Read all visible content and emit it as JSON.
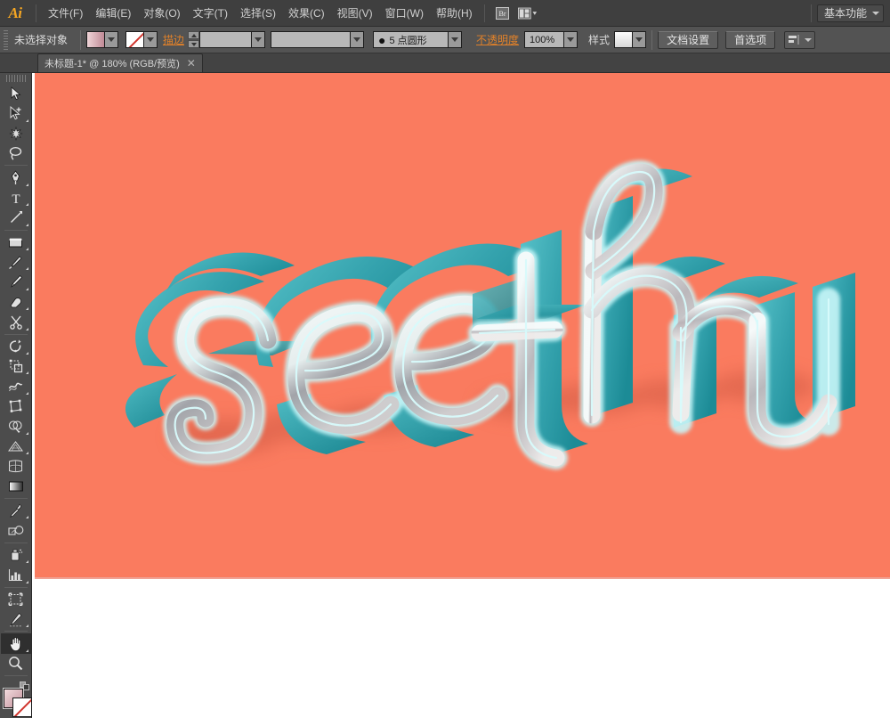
{
  "app": {
    "name": "Adobe Illustrator",
    "logo_text": "Ai"
  },
  "menubar": {
    "items": [
      {
        "label": "文件(F)",
        "name": "menu-file"
      },
      {
        "label": "编辑(E)",
        "name": "menu-edit"
      },
      {
        "label": "对象(O)",
        "name": "menu-object"
      },
      {
        "label": "文字(T)",
        "name": "menu-type"
      },
      {
        "label": "选择(S)",
        "name": "menu-select"
      },
      {
        "label": "效果(C)",
        "name": "menu-effect"
      },
      {
        "label": "视图(V)",
        "name": "menu-view"
      },
      {
        "label": "窗口(W)",
        "name": "menu-window"
      },
      {
        "label": "帮助(H)",
        "name": "menu-help"
      }
    ],
    "bridge_icon": "bridge-icon",
    "arrange_icon": "arrange-documents-icon",
    "workspace": "基本功能"
  },
  "controlbar": {
    "selection_status": "未选择对象",
    "fill_label": "fill-swatch",
    "stroke_color_label": "stroke-color-swatch",
    "stroke_label": "描边",
    "stroke_weight_value": "",
    "stroke_profile_value": "",
    "brush_value": "5 点圆形",
    "brush_bullet": "●",
    "opacity_label": "不透明度",
    "opacity_value": "100%",
    "style_label": "样式",
    "document_setup": "文档设置",
    "preferences": "首选项",
    "align_icon": "align-objects-icon"
  },
  "tabbar": {
    "document_title": "未标题-1* @ 180% (RGB/预览)",
    "close_glyph": "✕"
  },
  "toolbar": {
    "tools": [
      {
        "name": "selection-tool",
        "title": "选择工具",
        "active": false,
        "corner": false
      },
      {
        "name": "direct-selection-tool",
        "title": "直接选择工具",
        "active": false,
        "corner": true
      },
      {
        "name": "magic-wand-tool",
        "title": "魔棒工具",
        "active": false,
        "corner": false
      },
      {
        "name": "lasso-tool",
        "title": "套索工具",
        "active": false,
        "corner": false
      },
      {
        "name": "pen-tool",
        "title": "钢笔工具",
        "active": false,
        "corner": true
      },
      {
        "name": "type-tool",
        "title": "文字工具",
        "active": false,
        "corner": true
      },
      {
        "name": "line-segment-tool",
        "title": "直线段工具",
        "active": false,
        "corner": true
      },
      {
        "name": "rectangle-tool",
        "title": "矩形工具",
        "active": false,
        "corner": true
      },
      {
        "name": "paintbrush-tool",
        "title": "画笔工具",
        "active": false,
        "corner": true
      },
      {
        "name": "pencil-tool",
        "title": "铅笔工具",
        "active": false,
        "corner": true
      },
      {
        "name": "blob-brush-tool",
        "title": "斑点画笔工具",
        "active": false,
        "corner": false
      },
      {
        "name": "eraser-tool",
        "title": "橡皮擦工具",
        "active": false,
        "corner": true
      },
      {
        "name": "scissors-tool",
        "title": "剪刀工具",
        "active": false,
        "corner": true
      },
      {
        "name": "rotate-tool",
        "title": "旋转工具",
        "active": false,
        "corner": true
      },
      {
        "name": "scale-tool",
        "title": "比例缩放工具",
        "active": false,
        "corner": true
      },
      {
        "name": "width-tool",
        "title": "宽度工具",
        "active": false,
        "corner": true
      },
      {
        "name": "free-transform-tool",
        "title": "自由变换工具",
        "active": false,
        "corner": false
      },
      {
        "name": "shape-builder-tool",
        "title": "形状生成器工具",
        "active": false,
        "corner": true
      },
      {
        "name": "perspective-grid-tool",
        "title": "透视网格工具",
        "active": false,
        "corner": true
      },
      {
        "name": "mesh-tool",
        "title": "网格工具",
        "active": false,
        "corner": false
      },
      {
        "name": "gradient-tool",
        "title": "渐变工具",
        "active": false,
        "corner": false
      },
      {
        "name": "eyedropper-tool",
        "title": "吸管工具",
        "active": false,
        "corner": true
      },
      {
        "name": "blend-tool",
        "title": "混合工具",
        "active": false,
        "corner": false
      },
      {
        "name": "symbol-sprayer-tool",
        "title": "符号喷枪工具",
        "active": false,
        "corner": true
      },
      {
        "name": "column-graph-tool",
        "title": "柱形图工具",
        "active": false,
        "corner": true
      },
      {
        "name": "artboard-tool",
        "title": "画板工具",
        "active": false,
        "corner": false
      },
      {
        "name": "slice-tool",
        "title": "切片工具",
        "active": false,
        "corner": true
      },
      {
        "name": "hand-tool",
        "title": "抓手工具",
        "active": true,
        "corner": true
      },
      {
        "name": "zoom-tool",
        "title": "缩放工具",
        "active": false,
        "corner": false
      }
    ],
    "fill_swatch": "fill-color-swatch",
    "stroke_swatch": "stroke-color-swatch-none"
  },
  "canvas": {
    "artboard_color": "#fa7b5f",
    "artwork_text": "see thru",
    "artwork_description": "3D 立体字母 see thru",
    "letters": [
      "s",
      "e",
      "e",
      "t",
      "h",
      "r",
      "u"
    ],
    "colors": {
      "background": "#fa7b5f",
      "face_teal_light": "#4fb9c4",
      "face_teal_dark": "#1f8a95",
      "extrude_teal": "#3aa9b4",
      "outline_cyan": "#b9f4f7",
      "shadow": "#e8705a",
      "highlight_white": "#f2f6f5"
    },
    "zoom_level": "180%",
    "color_mode": "RGB",
    "view_mode": "预览"
  }
}
